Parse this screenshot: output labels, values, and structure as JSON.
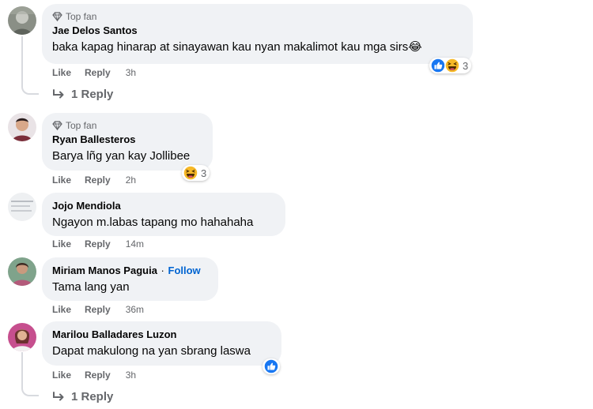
{
  "comments": [
    {
      "top_fan": true,
      "badge_label": "Top fan",
      "author": "Jae Delos Santos",
      "text": "baka kapag hinarap at sinayawan kau nyan makalimot kau mga sirs😂",
      "reactions": [
        "like",
        "haha"
      ],
      "reaction_count": "3",
      "actions": {
        "like": "Like",
        "reply": "Reply",
        "time": "3h"
      },
      "replies_label": "1 Reply"
    },
    {
      "top_fan": true,
      "badge_label": "Top fan",
      "author": "Ryan Ballesteros",
      "text": "Barya lñg yan kay Jollibee",
      "reactions": [
        "haha"
      ],
      "reaction_count": "3",
      "actions": {
        "like": "Like",
        "reply": "Reply",
        "time": "2h"
      }
    },
    {
      "author": "Jojo Mendiola",
      "text": "Ngayon m.labas tapang mo hahahaha",
      "actions": {
        "like": "Like",
        "reply": "Reply",
        "time": "14m"
      }
    },
    {
      "author": "Miriam Manos Paguia",
      "separator": "·",
      "follow_label": "Follow",
      "text": "Tama lang yan",
      "actions": {
        "like": "Like",
        "reply": "Reply",
        "time": "36m"
      }
    },
    {
      "author": "Marilou Balladares Luzon",
      "text": "Dapat makulong na yan sbrang laswa",
      "reactions": [
        "like"
      ],
      "actions": {
        "like": "Like",
        "reply": "Reply",
        "time": "3h"
      },
      "replies_label": "1 Reply"
    }
  ],
  "colors": {
    "bubble": "#f0f2f5",
    "secondary_text": "#65676b",
    "link_blue": "#0064d1",
    "like_blue": "#1877f2"
  },
  "icons": [
    "diamond-icon",
    "like-reaction-icon",
    "haha-reaction-icon",
    "reply-arrow-icon"
  ]
}
